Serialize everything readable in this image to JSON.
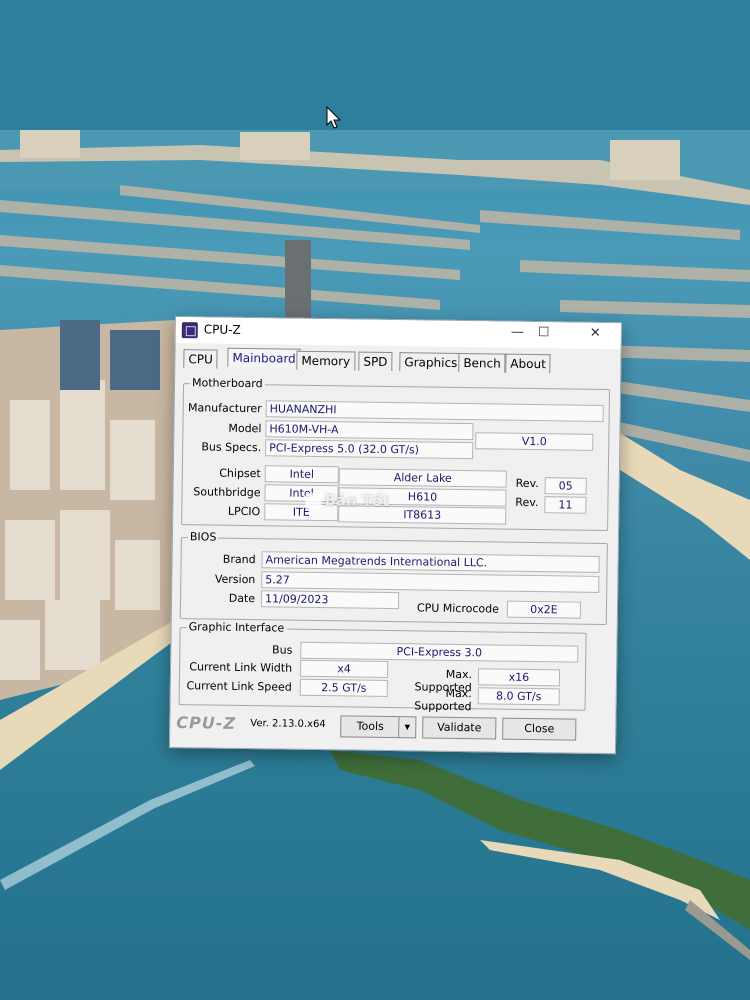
{
  "window": {
    "title": "CPU-Z",
    "controls": {
      "minimize": "—",
      "maximize": "☐",
      "close": "✕"
    }
  },
  "tabs": [
    {
      "label": "CPU"
    },
    {
      "label": "Mainboard"
    },
    {
      "label": "Memory"
    },
    {
      "label": "SPD"
    },
    {
      "label": "Graphics"
    },
    {
      "label": "Bench"
    },
    {
      "label": "About"
    }
  ],
  "motherboard": {
    "group_title": "Motherboard",
    "manufacturer_label": "Manufacturer",
    "manufacturer": "HUANANZHI",
    "model_label": "Model",
    "model": "H610M-VH-A",
    "model_rev": "V1.0",
    "bus_label": "Bus Specs.",
    "bus": "PCI-Express 5.0 (32.0 GT/s)",
    "chipset_label": "Chipset",
    "chipset_vendor": "Intel",
    "chipset_name": "Alder Lake",
    "chipset_rev_label": "Rev.",
    "chipset_rev": "05",
    "southbridge_label": "Southbridge",
    "southbridge_vendor": "Intel",
    "southbridge_name": "H610",
    "southbridge_rev_label": "Rev.",
    "southbridge_rev": "11",
    "lpcio_label": "LPCIO",
    "lpcio_vendor": "ITE",
    "lpcio_name": "IT8613"
  },
  "bios": {
    "group_title": "BIOS",
    "brand_label": "Brand",
    "brand": "American Megatrends International LLC.",
    "version_label": "Version",
    "version": "5.27",
    "date_label": "Date",
    "date": "11/09/2023",
    "microcode_label": "CPU Microcode",
    "microcode": "0x2E"
  },
  "graphic": {
    "group_title": "Graphic Interface",
    "bus_label": "Bus",
    "bus": "PCI-Express 3.0",
    "link_width_label": "Current Link Width",
    "link_width": "x4",
    "max_width_label": "Max. Supported",
    "max_width": "x16",
    "link_speed_label": "Current Link Speed",
    "link_speed": "2.5 GT/s",
    "max_speed_label": "Max. Supported",
    "max_speed": "8.0 GT/s"
  },
  "footer": {
    "logo": "CPU-Z",
    "version": "Ver. 2.13.0.x64",
    "tools": "Tools",
    "validate": "Validate",
    "close": "Close"
  },
  "watermark": "Bán Tốt",
  "colors": {
    "value_text": "#1a1a6e",
    "active_tab": "#1a1a8c",
    "sea": "#2f7f9c"
  }
}
